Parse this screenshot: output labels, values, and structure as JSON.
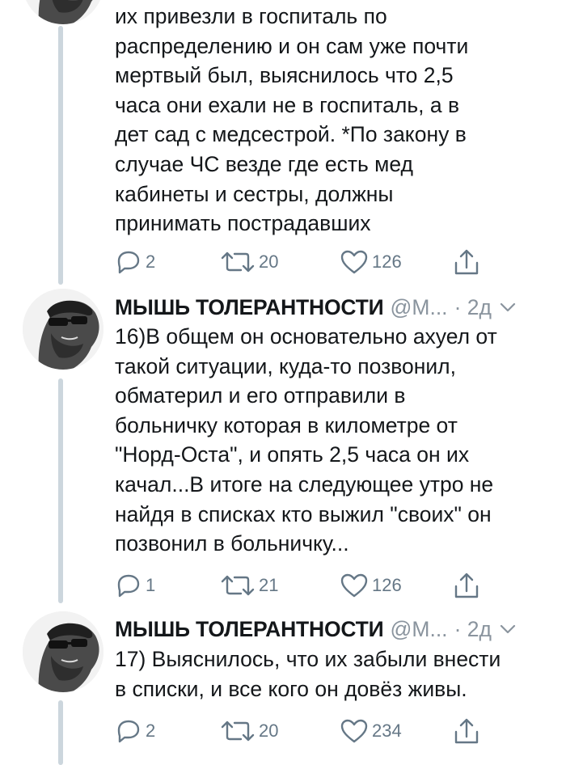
{
  "tweets": [
    {
      "text": "их привезли в госпиталь по\nраспределению и он сам уже почти\nмертвый был, выяснилось что 2,5\nчаса они ехали не в госпиталь, а в\nдет сад с медсестрой. *По закону в\nслучае ЧС везде где есть мед\nкабинеты и сестры, должны\nпринимать пострадавших",
      "replies": "2",
      "retweets": "20",
      "likes": "126"
    },
    {
      "name": "МЫШЬ ТОЛЕРАНТНОСТИ",
      "handle": "@M...",
      "time": "· 2д",
      "text": "16)В общем он основательно ахуел от\nтакой ситуации, куда-то позвонил,\nобматерил и его отправили в\nбольничку которая в километре от\n\"Норд-Оста\", и опять 2,5 часа он их\nкачал...В итоге на следующее утро не\nнайдя в списках кто выжил \"своих\" он\nпозвонил в больничку...",
      "replies": "1",
      "retweets": "21",
      "likes": "126"
    },
    {
      "name": "МЫШЬ ТОЛЕРАНТНОСТИ",
      "handle": "@M...",
      "time": "· 2д",
      "text": "17) Выяснилось, что их забыли внести\nв списки, и все кого он довёз живы.",
      "replies": "2",
      "retweets": "20",
      "likes": "234"
    }
  ],
  "icons": {
    "reply": "reply-icon",
    "retweet": "retweet-icon",
    "like": "heart-icon",
    "share": "share-icon",
    "caret": "chevron-down-icon"
  },
  "colors": {
    "text": "#14171a",
    "secondary": "#657786",
    "thread_line": "#ccd6dd"
  }
}
